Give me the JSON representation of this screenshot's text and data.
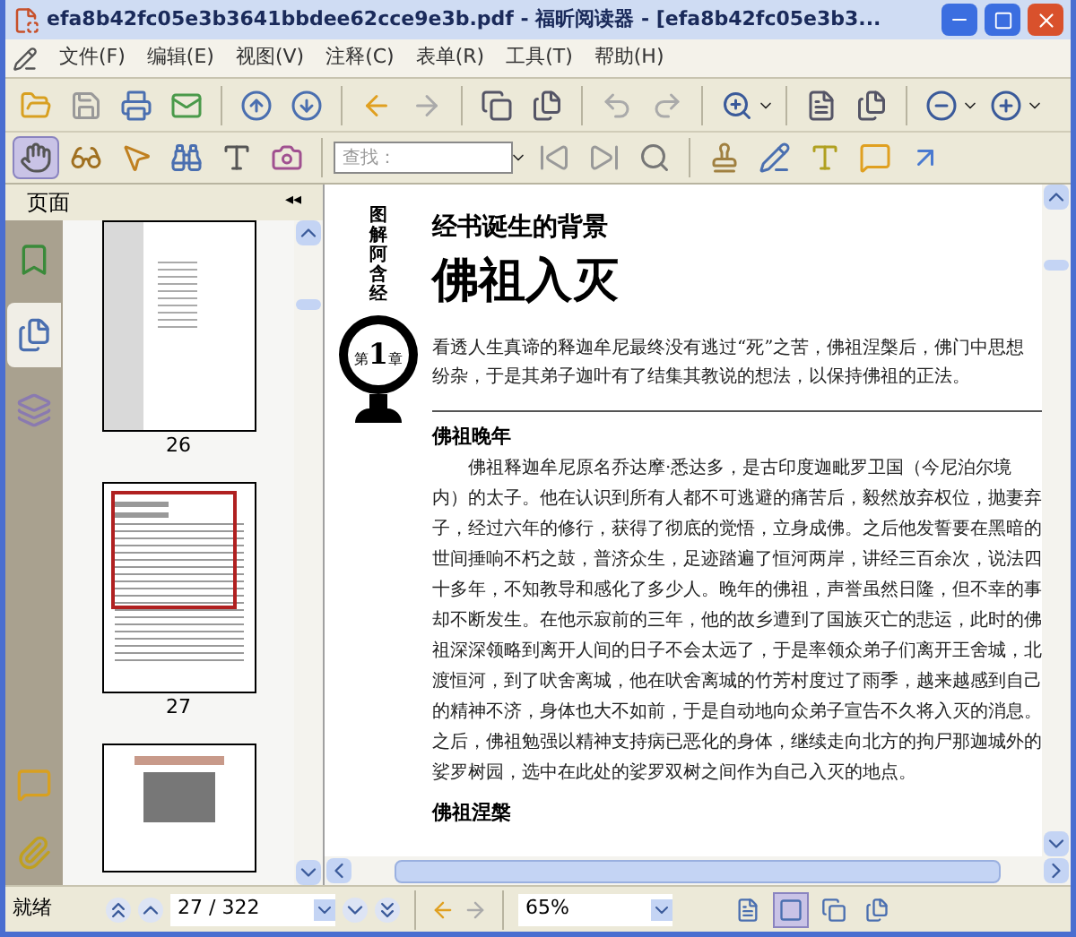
{
  "window": {
    "title": "efa8b42fc05e3b3641bbdee62cce9e3b.pdf - 福昕阅读器 - [efa8b42fc05e3b3..."
  },
  "menu": [
    "文件(F)",
    "编辑(E)",
    "视图(V)",
    "注释(C)",
    "表单(R)",
    "工具(T)",
    "帮助(H)"
  ],
  "search": {
    "placeholder": "查找："
  },
  "sidebar": {
    "title": "页面",
    "collapse": "◂◂",
    "tabs": [
      {
        "kind": "bookmarks",
        "selected": false
      },
      {
        "kind": "pages",
        "selected": true
      },
      {
        "kind": "layers",
        "selected": false
      }
    ],
    "thumbnails": [
      {
        "kind": "contents",
        "label": "26",
        "selected": false
      },
      {
        "kind": "text",
        "label": "27",
        "selected": true
      },
      {
        "kind": "image",
        "selected": false
      }
    ]
  },
  "document": {
    "series": "图解阿含经",
    "badge": {
      "prefix": "第",
      "number": "1",
      "suffix": "章"
    },
    "subtitle": "经书诞生的背景",
    "title": "佛祖入灭",
    "intro": "看透人生真谛的释迦牟尼最终没有逃过“死”之苦，佛祖涅槃后，佛门中思想纷杂，于是其弟子迦叶有了结集其教说的想法，以保持佛祖的正法。",
    "sections": [
      {
        "heading": "佛祖晚年",
        "paragraph": "佛祖释迦牟尼原名乔达摩·悉达多，是古印度迦毗罗卫国（今尼泊尔境内）的太子。他在认识到所有人都不可逃避的痛苦后，毅然放弃权位，抛妻弃子，经过六年的修行，获得了彻底的觉悟，立身成佛。之后他发誓要在黑暗的世间捶响不朽之鼓，普济众生，足迹踏遍了恒河两岸，讲经三百余次，说法四十多年，不知教导和感化了多少人。晚年的佛祖，声誉虽然日隆，但不幸的事却不断发生。在他示寂前的三年，他的故乡遭到了国族灭亡的悲运，此时的佛祖深深领略到离开人间的日子不会太远了，于是率领众弟子们离开王舍城，北渡恒河，到了吠舍离城，他在吠舍离城的竹芳村度过了雨季，越来越感到自己的精神不济，身体也大不如前，于是自动地向众弟子宣告不久将入灭的消息。之后，佛祖勉强以精神支持病已恶化的身体，继续走向北方的拘尸那迦城外的娑罗树园，选中在此处的娑罗双树之间作为自己入灭的地点。"
      },
      {
        "heading": "佛祖涅槃"
      }
    ]
  },
  "status_bar": {
    "status": "就绪",
    "page": "27 / 322",
    "zoom": "65%",
    "view_modes": [
      {
        "kind": "single",
        "selected": false
      },
      {
        "kind": "continuous",
        "selected": true
      },
      {
        "kind": "facing",
        "selected": false
      },
      {
        "kind": "continuous-facing",
        "selected": false
      }
    ]
  }
}
